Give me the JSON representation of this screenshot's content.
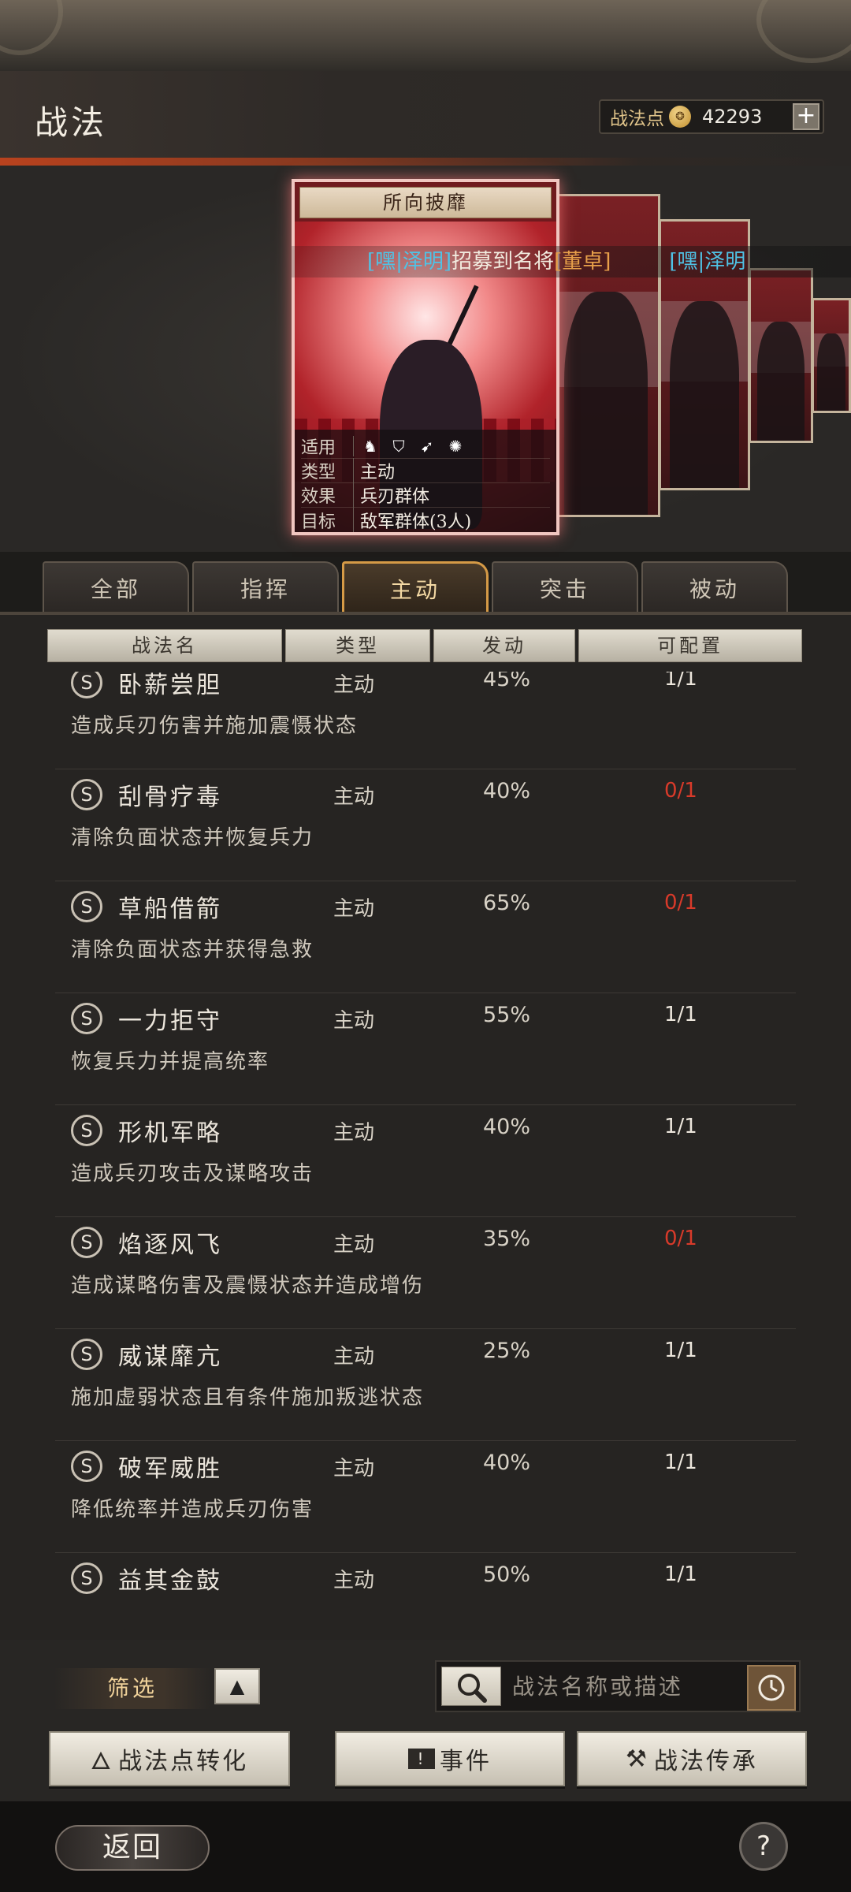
{
  "header": {
    "title": "战法",
    "points_label": "战法点",
    "points_value": "42293",
    "add_icon": "plus-icon",
    "coin_icon": "coin-icon"
  },
  "featured_card": {
    "name": "所向披靡",
    "rows": [
      {
        "key": "适用",
        "value": ""
      },
      {
        "key": "类型",
        "value": "主动"
      },
      {
        "key": "效果",
        "value": "兵刃群体"
      },
      {
        "key": "目标",
        "value": "敌军群体(3人)"
      }
    ],
    "unit_icons": [
      "cavalry-icon",
      "shield-icon",
      "archer-icon",
      "spear-wheel-icon"
    ]
  },
  "ticker": {
    "player": "[嘿|泽明]",
    "text": "招募到名将",
    "hero": "[董卓]",
    "next_player": "[嘿|泽明"
  },
  "tabs": [
    "全部",
    "指挥",
    "主动",
    "突击",
    "被动"
  ],
  "active_tab": "主动",
  "columns": [
    "战法名",
    "类型",
    "发动",
    "可配置"
  ],
  "tactics": [
    {
      "grade": "S",
      "name": "卧薪尝胆",
      "type": "主动",
      "rate": "45%",
      "config": "1/1",
      "config_full": false,
      "desc": "造成兵刃伤害并施加震慑状态"
    },
    {
      "grade": "S",
      "name": "刮骨疗毒",
      "type": "主动",
      "rate": "40%",
      "config": "0/1",
      "config_full": true,
      "desc": "清除负面状态并恢复兵力"
    },
    {
      "grade": "S",
      "name": "草船借箭",
      "type": "主动",
      "rate": "65%",
      "config": "0/1",
      "config_full": true,
      "desc": "清除负面状态并获得急救"
    },
    {
      "grade": "S",
      "name": "一力拒守",
      "type": "主动",
      "rate": "55%",
      "config": "1/1",
      "config_full": false,
      "desc": "恢复兵力并提高统率"
    },
    {
      "grade": "S",
      "name": "形机军略",
      "type": "主动",
      "rate": "40%",
      "config": "1/1",
      "config_full": false,
      "desc": "造成兵刃攻击及谋略攻击"
    },
    {
      "grade": "S",
      "name": "焰逐风飞",
      "type": "主动",
      "rate": "35%",
      "config": "0/1",
      "config_full": true,
      "desc": "造成谋略伤害及震慑状态并造成增伤"
    },
    {
      "grade": "S",
      "name": "威谋靡亢",
      "type": "主动",
      "rate": "25%",
      "config": "1/1",
      "config_full": false,
      "desc": "施加虚弱状态且有条件施加叛逃状态"
    },
    {
      "grade": "S",
      "name": "破军威胜",
      "type": "主动",
      "rate": "40%",
      "config": "1/1",
      "config_full": false,
      "desc": "降低统率并造成兵刃伤害"
    },
    {
      "grade": "S",
      "name": "益其金鼓",
      "type": "主动",
      "rate": "50%",
      "config": "1/1",
      "config_full": false,
      "desc": ""
    }
  ],
  "colors": {
    "accent_gold": "#d59a46",
    "config_red": "#d83a2a",
    "ticker_blue": "#4fc3e6",
    "ticker_orange": "#e8a04a"
  },
  "filter": {
    "label": "筛选",
    "toggle_icon": "triangle-up-icon"
  },
  "search": {
    "placeholder": "战法名称或描述",
    "icon": "search-icon",
    "history_icon": "clock-icon"
  },
  "actions": [
    {
      "label": "战法点转化",
      "icon": "flame-icon"
    },
    {
      "label": "事件",
      "icon": "alert-icon"
    },
    {
      "label": "战法传承",
      "icon": "hammer-icon"
    }
  ],
  "footer": {
    "back_label": "返回",
    "help_label": "?"
  }
}
